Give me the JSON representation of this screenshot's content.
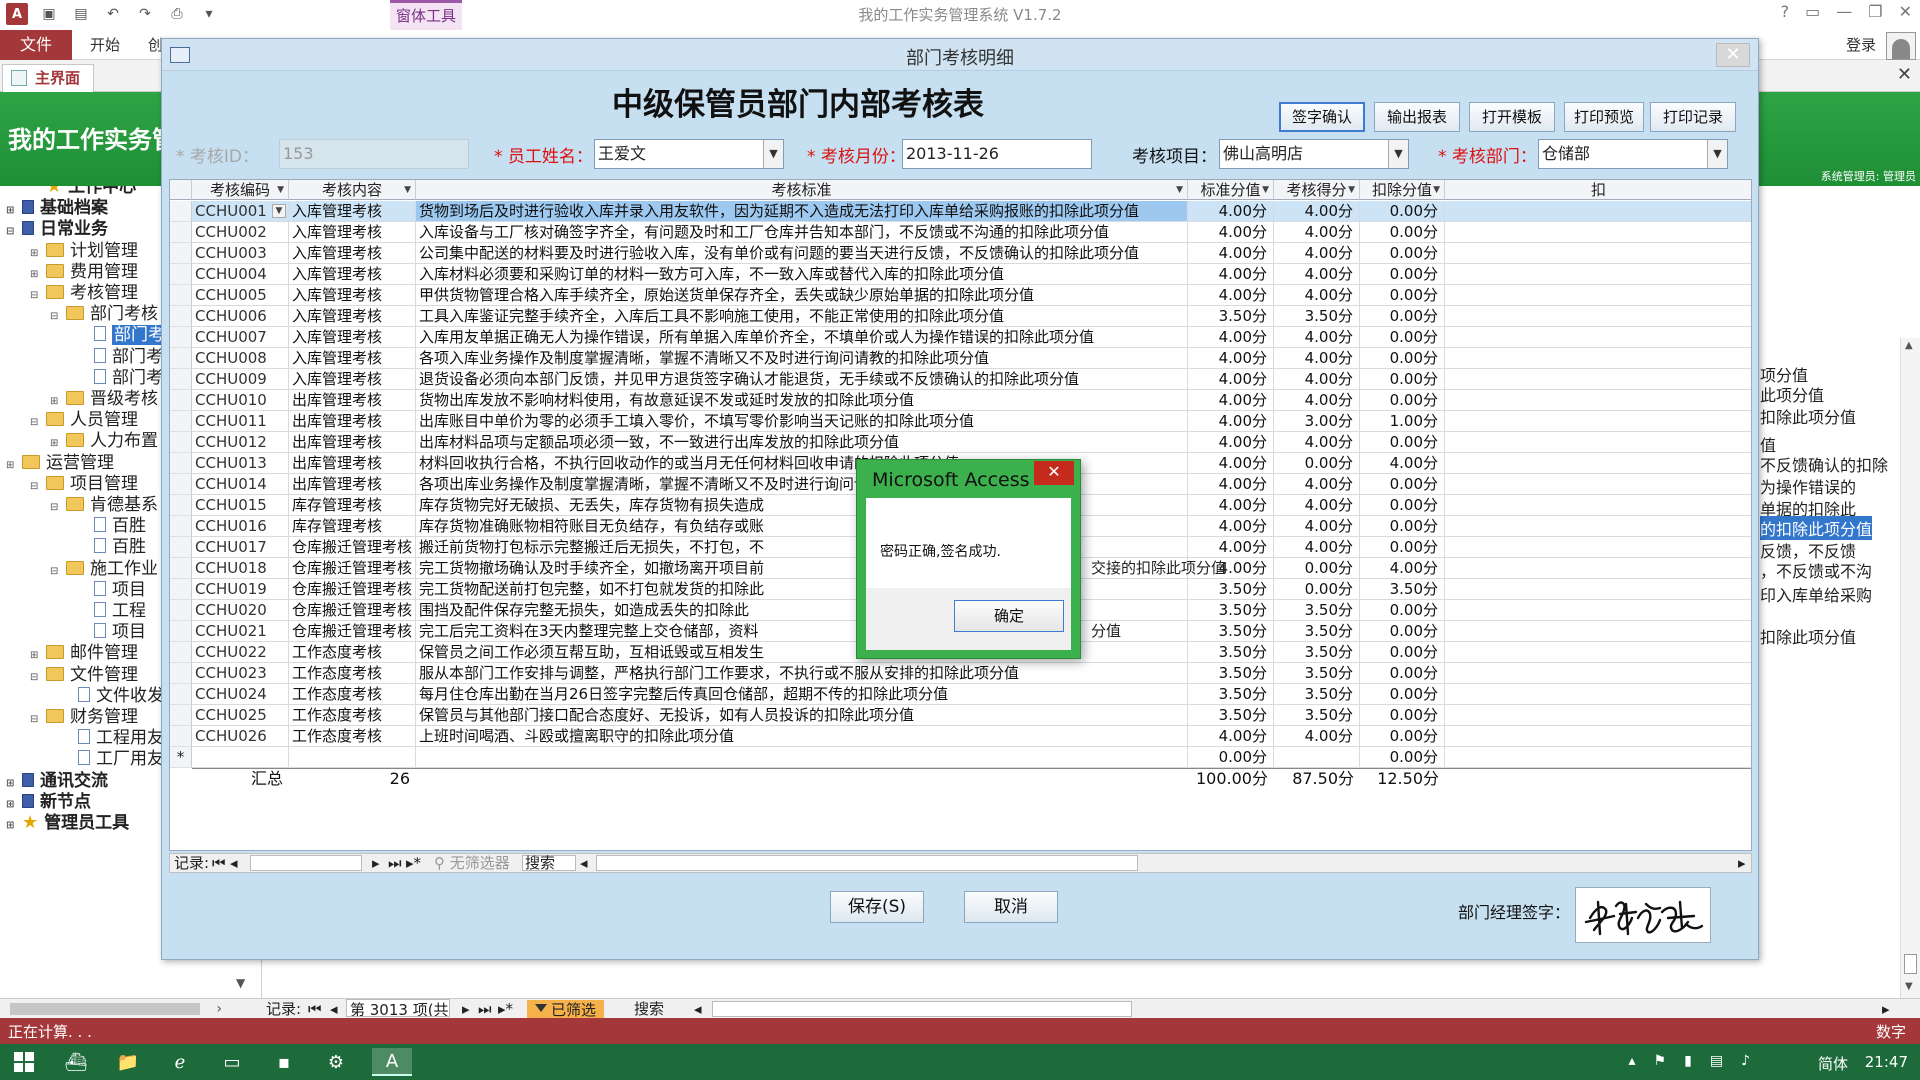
{
  "app": {
    "title": "我的工作实务管理系统 V1.7.2",
    "context_tab": "窗体工具",
    "file_tab": "文件",
    "ribbon_tabs": [
      "开始",
      "创"
    ],
    "login": "登录",
    "doc_tab": "主界面",
    "banner_title": "我的工作实务管",
    "banner_admin": "系统管理员: 管理员",
    "status_left": "正在计算. . .",
    "status_right": "数字"
  },
  "colors": {
    "access_red": "#a4373a",
    "banner_green": "#2ea445",
    "form_bg": "#c6e0f1",
    "required_label": "#d11111",
    "selection_blue": "#3377cc",
    "taskbar_green": "#1d6b3a",
    "dialog_border": "#3db04e"
  },
  "nav": {
    "items": [
      {
        "label": "工作中心",
        "icon": "star-icon",
        "bold": true
      },
      {
        "label": "基础档案",
        "icon": "book-icon",
        "bold": true,
        "exp": "+"
      },
      {
        "label": "日常业务",
        "icon": "book-icon",
        "bold": true,
        "exp": "−"
      },
      {
        "label": "计划管理",
        "icon": "folder-icon",
        "exp": "+"
      },
      {
        "label": "费用管理",
        "icon": "folder-icon",
        "exp": "+"
      },
      {
        "label": "考核管理",
        "icon": "folder-icon",
        "exp": "−"
      },
      {
        "label": "部门考核",
        "icon": "folder-icon",
        "exp": "−"
      },
      {
        "label": "部门考",
        "icon": "form-icon",
        "selected": true
      },
      {
        "label": "部门考",
        "icon": "form-icon"
      },
      {
        "label": "部门考",
        "icon": "form-icon"
      },
      {
        "label": "晋级考核",
        "icon": "folder-icon",
        "exp": "+"
      },
      {
        "label": "人员管理",
        "icon": "folder-icon",
        "exp": "−"
      },
      {
        "label": "人力布置",
        "icon": "folder-icon",
        "exp": "+"
      },
      {
        "label": "运营管理",
        "icon": "folder-icon",
        "exp": "+"
      },
      {
        "label": "项目管理",
        "icon": "folder-icon",
        "exp": "−"
      },
      {
        "label": "肯德基系",
        "icon": "folder-icon",
        "exp": "−"
      },
      {
        "label": "百胜",
        "icon": "form-icon"
      },
      {
        "label": "百胜",
        "icon": "form-icon"
      },
      {
        "label": "施工作业",
        "icon": "folder-icon",
        "exp": "−"
      },
      {
        "label": "项目",
        "icon": "form-icon"
      },
      {
        "label": "工程",
        "icon": "form-icon"
      },
      {
        "label": "项目",
        "icon": "form-icon"
      },
      {
        "label": "邮件管理",
        "icon": "folder-icon",
        "exp": "+"
      },
      {
        "label": "文件管理",
        "icon": "folder-icon",
        "exp": "−"
      },
      {
        "label": "文件收发",
        "icon": "form-icon"
      },
      {
        "label": "财务管理",
        "icon": "folder-icon",
        "exp": "−"
      },
      {
        "label": "工程用友",
        "icon": "form-icon"
      },
      {
        "label": "工厂用友",
        "icon": "form-icon"
      },
      {
        "label": "通讯交流",
        "icon": "book-icon",
        "bold": true,
        "exp": "+"
      },
      {
        "label": "新节点",
        "icon": "book-icon",
        "bold": true,
        "exp": "+"
      },
      {
        "label": "管理员工具",
        "icon": "star-icon",
        "bold": true,
        "exp": "+"
      }
    ]
  },
  "background_texts": [
    "项分值",
    "此项分值",
    "扣除此项分值",
    "值",
    "不反馈确认的扣除",
    "为操作错误的",
    "单据的扣除此",
    "的扣除此项分值",
    "反馈，不反馈",
    "，不反馈或不沟",
    "印入库单给采购",
    "扣除此项分值"
  ],
  "outer_nav": {
    "label": "记录:",
    "position": "第 3013 项(共 3(",
    "filter": "已筛选",
    "search": "搜索"
  },
  "form": {
    "window_title": "部门考核明细",
    "heading": "中级保管员部门内部考核表",
    "buttons": {
      "sign": "签字确认",
      "export": "输出报表",
      "template": "打开模板",
      "preview": "打印预览",
      "print_log": "打印记录"
    },
    "fields": {
      "id_label": "* 考核ID：",
      "id_value": "153",
      "name_label": "* 员工姓名：",
      "name_value": "王爱文",
      "month_label": "* 考核月份：",
      "month_value": "2013-11-26",
      "project_label": "考核项目：",
      "project_value": "佛山高明店",
      "dept_label": "* 考核部门：",
      "dept_value": "仓储部"
    },
    "grid": {
      "headers": [
        "考核编码",
        "考核内容",
        "考核标准",
        "标准分值",
        "考核得分",
        "扣除分值",
        "扣"
      ],
      "rows": [
        [
          "CCHU001",
          "入库管理考核",
          "货物到场后及时进行验收入库并录入用友软件，因为延期不入造成无法打印入库单给采购报账的扣除此项分值",
          "4.00分",
          "4.00分",
          "0.00分"
        ],
        [
          "CCHU002",
          "入库管理考核",
          "入库设备与工厂核对确签字齐全，有问题及时和工厂仓库并告知本部门，不反馈或不沟通的扣除此项分值",
          "4.00分",
          "4.00分",
          "0.00分"
        ],
        [
          "CCHU003",
          "入库管理考核",
          "公司集中配送的材料要及时进行验收入库，没有单价或有问题的要当天进行反馈，不反馈确认的扣除此项分值",
          "4.00分",
          "4.00分",
          "0.00分"
        ],
        [
          "CCHU004",
          "入库管理考核",
          "入库材料必须要和采购订单的材料一致方可入库，不一致入库或替代入库的扣除此项分值",
          "4.00分",
          "4.00分",
          "0.00分"
        ],
        [
          "CCHU005",
          "入库管理考核",
          "甲供货物管理合格入库手续齐全，原始送货单保存齐全，丢失或缺少原始单据的扣除此项分值",
          "4.00分",
          "4.00分",
          "0.00分"
        ],
        [
          "CCHU006",
          "入库管理考核",
          "工具入库鉴证完整手续齐全，入库后工具不影响施工使用，不能正常使用的扣除此项分值",
          "3.50分",
          "3.50分",
          "0.00分"
        ],
        [
          "CCHU007",
          "入库管理考核",
          "入库用友单据正确无人为操作错误，所有单据入库单价齐全，不填单价或人为操作错误的扣除此项分值",
          "4.00分",
          "4.00分",
          "0.00分"
        ],
        [
          "CCHU008",
          "入库管理考核",
          "各项入库业务操作及制度掌握清晰，掌握不清晰又不及时进行询问请教的扣除此项分值",
          "4.00分",
          "4.00分",
          "0.00分"
        ],
        [
          "CCHU009",
          "入库管理考核",
          "退货设备必须向本部门反馈，并见甲方退货签字确认才能退货，无手续或不反馈确认的扣除此项分值",
          "4.00分",
          "4.00分",
          "0.00分"
        ],
        [
          "CCHU010",
          "出库管理考核",
          "货物出库发放不影响材料使用，有故意延误不发或延时发放的扣除此项分值",
          "4.00分",
          "4.00分",
          "0.00分"
        ],
        [
          "CCHU011",
          "出库管理考核",
          "出库账目中单价为零的必须手工填入零价，不填写零价影响当天记账的扣除此项分值",
          "4.00分",
          "3.00分",
          "1.00分"
        ],
        [
          "CCHU012",
          "出库管理考核",
          "出库材料品项与定额品项必须一致，不一致进行出库发放的扣除此项分值",
          "4.00分",
          "4.00分",
          "0.00分"
        ],
        [
          "CCHU013",
          "出库管理考核",
          "材料回收执行合格，不执行回收动作的或当月无任何材料回收申请的扣除此项分值",
          "4.00分",
          "0.00分",
          "4.00分"
        ],
        [
          "CCHU014",
          "出库管理考核",
          "各项出库业务操作及制度掌握清晰，掌握不清晰又不及时进行询问请教的扣除此项分值",
          "4.00分",
          "4.00分",
          "0.00分"
        ],
        [
          "CCHU015",
          "库存管理考核",
          "库存货物完好无破损、无丢失，库存货物有损失造成",
          "4.00分",
          "4.00分",
          "0.00分"
        ],
        [
          "CCHU016",
          "库存管理考核",
          "库存货物准确账物相符账目无负结存，有负结存或账",
          "4.00分",
          "4.00分",
          "0.00分"
        ],
        [
          "CCHU017",
          "仓库搬迁管理考核",
          "搬迁前货物打包标示完整搬迁后无损失，不打包，不",
          "4.00分",
          "4.00分",
          "0.00分"
        ],
        [
          "CCHU018",
          "仓库搬迁管理考核",
          "完工货物撤场确认及时手续齐全，如撤场离开项目前",
          "4.00分",
          "0.00分",
          "4.00分"
        ],
        [
          "CCHU019",
          "仓库搬迁管理考核",
          "完工货物配送前打包完整，如不打包就发货的扣除此",
          "3.50分",
          "0.00分",
          "3.50分"
        ],
        [
          "CCHU020",
          "仓库搬迁管理考核",
          "围挡及配件保存完整无损失，如造成丢失的扣除此",
          "3.50分",
          "3.50分",
          "0.00分"
        ],
        [
          "CCHU021",
          "仓库搬迁管理考核",
          "完工后完工资料在3天内整理完整上交仓储部，资料",
          "3.50分",
          "3.50分",
          "0.00分"
        ],
        [
          "CCHU022",
          "工作态度考核",
          "保管员之间工作必须互帮互助，互相诋毁或互相发生",
          "3.50分",
          "3.50分",
          "0.00分"
        ],
        [
          "CCHU023",
          "工作态度考核",
          "服从本部门工作安排与调整，严格执行部门工作要求，不执行或不服从安排的扣除此项分值",
          "3.50分",
          "3.50分",
          "0.00分"
        ],
        [
          "CCHU024",
          "工作态度考核",
          "每月住仓库出勤在当月26日签字完整后传真回仓储部，超期不传的扣除此项分值",
          "3.50分",
          "3.50分",
          "0.00分"
        ],
        [
          "CCHU025",
          "工作态度考核",
          "保管员与其他部门接口配合态度好、无投诉，如有人员投诉的扣除此项分值",
          "3.50分",
          "3.50分",
          "0.00分"
        ],
        [
          "CCHU026",
          "工作态度考核",
          "上班时间喝酒、斗殴或擅离职守的扣除此项分值",
          "4.00分",
          "4.00分",
          "0.00分"
        ]
      ],
      "tail_fragments": [
        "交接的扣除此项分值",
        "分值"
      ],
      "new_row": {
        "marker": "*",
        "std": "0.00分",
        "ded": "0.00分"
      },
      "summary": {
        "label": "汇总",
        "count": "26",
        "std": "100.00分",
        "score": "87.50分",
        "ded": "12.50分"
      }
    },
    "inner_nav": {
      "label": "记录:",
      "filter": "无筛选器",
      "search": "搜索"
    },
    "save": "保存(S)",
    "cancel": "取消",
    "sig_label": "部门经理签字："
  },
  "dialog": {
    "title": "Microsoft Access",
    "message": "密码正确,签名成功.",
    "ok": "确定"
  },
  "taskbar": {
    "ime": "简体",
    "time": "21:47"
  }
}
